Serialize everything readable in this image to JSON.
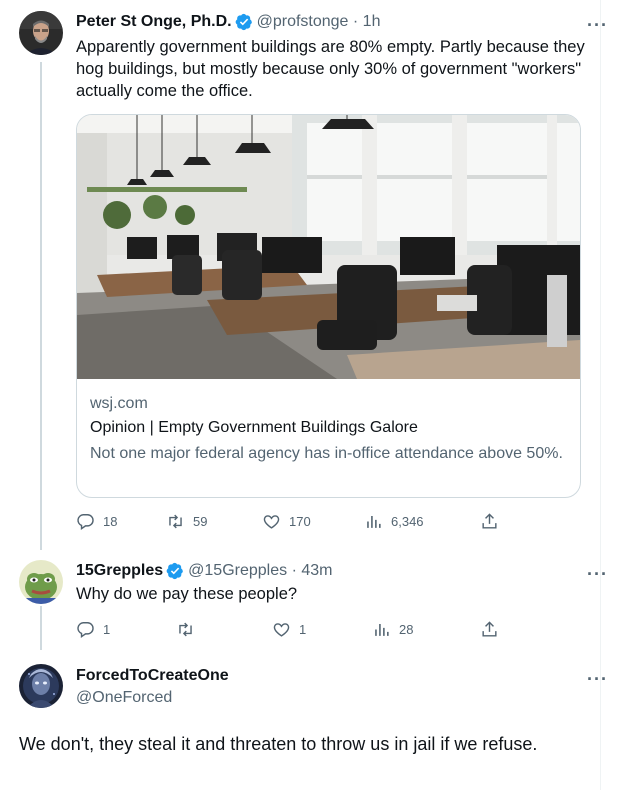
{
  "tweets": [
    {
      "name": "Peter St Onge, Ph.D.",
      "handle": "@profstonge · 1h",
      "text": "Apparently government buildings are 80% empty. Partly because they hog buildings, but mostly because only 30% of government \"workers\" actually come the office.",
      "card": {
        "domain": "wsj.com",
        "title": "Opinion | Empty Government Buildings Galore",
        "description": "Not one major federal agency has in-office attendance above 50%."
      },
      "actions": {
        "replies": "18",
        "retweets": "59",
        "likes": "170",
        "views": "6,346"
      }
    },
    {
      "name": "15Grepples",
      "handle": "@15Grepples · 43m",
      "text": "Why do we pay these people?",
      "actions": {
        "replies": "1",
        "retweets": "",
        "likes": "1",
        "views": "28"
      }
    },
    {
      "name": "ForcedToCreateOne",
      "handle": "@OneForced",
      "text": "We don't, they steal it and threaten to throw us in jail if we refuse."
    }
  ],
  "more_label": "···",
  "icons": {
    "verified": "verified-badge-icon",
    "reply": "reply-icon",
    "retweet": "retweet-icon",
    "like": "heart-icon",
    "views": "views-icon",
    "share": "share-icon"
  },
  "colors": {
    "verified": "#1d9bf0",
    "text": "#0f1419",
    "secondary": "#536471",
    "border": "#cfd9de"
  }
}
